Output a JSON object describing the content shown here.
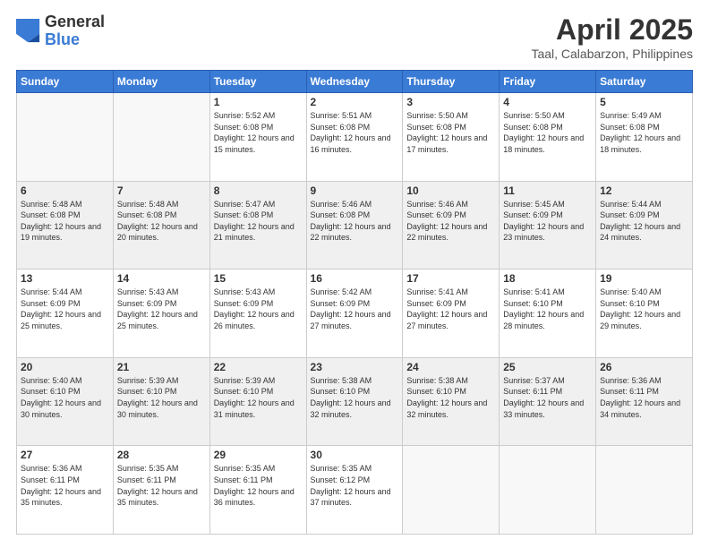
{
  "logo": {
    "general": "General",
    "blue": "Blue"
  },
  "title": {
    "month": "April 2025",
    "location": "Taal, Calabarzon, Philippines"
  },
  "days_of_week": [
    "Sunday",
    "Monday",
    "Tuesday",
    "Wednesday",
    "Thursday",
    "Friday",
    "Saturday"
  ],
  "weeks": [
    [
      {
        "day": "",
        "sunrise": "",
        "sunset": "",
        "daylight": ""
      },
      {
        "day": "",
        "sunrise": "",
        "sunset": "",
        "daylight": ""
      },
      {
        "day": "1",
        "sunrise": "Sunrise: 5:52 AM",
        "sunset": "Sunset: 6:08 PM",
        "daylight": "Daylight: 12 hours and 15 minutes."
      },
      {
        "day": "2",
        "sunrise": "Sunrise: 5:51 AM",
        "sunset": "Sunset: 6:08 PM",
        "daylight": "Daylight: 12 hours and 16 minutes."
      },
      {
        "day": "3",
        "sunrise": "Sunrise: 5:50 AM",
        "sunset": "Sunset: 6:08 PM",
        "daylight": "Daylight: 12 hours and 17 minutes."
      },
      {
        "day": "4",
        "sunrise": "Sunrise: 5:50 AM",
        "sunset": "Sunset: 6:08 PM",
        "daylight": "Daylight: 12 hours and 18 minutes."
      },
      {
        "day": "5",
        "sunrise": "Sunrise: 5:49 AM",
        "sunset": "Sunset: 6:08 PM",
        "daylight": "Daylight: 12 hours and 18 minutes."
      }
    ],
    [
      {
        "day": "6",
        "sunrise": "Sunrise: 5:48 AM",
        "sunset": "Sunset: 6:08 PM",
        "daylight": "Daylight: 12 hours and 19 minutes."
      },
      {
        "day": "7",
        "sunrise": "Sunrise: 5:48 AM",
        "sunset": "Sunset: 6:08 PM",
        "daylight": "Daylight: 12 hours and 20 minutes."
      },
      {
        "day": "8",
        "sunrise": "Sunrise: 5:47 AM",
        "sunset": "Sunset: 6:08 PM",
        "daylight": "Daylight: 12 hours and 21 minutes."
      },
      {
        "day": "9",
        "sunrise": "Sunrise: 5:46 AM",
        "sunset": "Sunset: 6:08 PM",
        "daylight": "Daylight: 12 hours and 22 minutes."
      },
      {
        "day": "10",
        "sunrise": "Sunrise: 5:46 AM",
        "sunset": "Sunset: 6:09 PM",
        "daylight": "Daylight: 12 hours and 22 minutes."
      },
      {
        "day": "11",
        "sunrise": "Sunrise: 5:45 AM",
        "sunset": "Sunset: 6:09 PM",
        "daylight": "Daylight: 12 hours and 23 minutes."
      },
      {
        "day": "12",
        "sunrise": "Sunrise: 5:44 AM",
        "sunset": "Sunset: 6:09 PM",
        "daylight": "Daylight: 12 hours and 24 minutes."
      }
    ],
    [
      {
        "day": "13",
        "sunrise": "Sunrise: 5:44 AM",
        "sunset": "Sunset: 6:09 PM",
        "daylight": "Daylight: 12 hours and 25 minutes."
      },
      {
        "day": "14",
        "sunrise": "Sunrise: 5:43 AM",
        "sunset": "Sunset: 6:09 PM",
        "daylight": "Daylight: 12 hours and 25 minutes."
      },
      {
        "day": "15",
        "sunrise": "Sunrise: 5:43 AM",
        "sunset": "Sunset: 6:09 PM",
        "daylight": "Daylight: 12 hours and 26 minutes."
      },
      {
        "day": "16",
        "sunrise": "Sunrise: 5:42 AM",
        "sunset": "Sunset: 6:09 PM",
        "daylight": "Daylight: 12 hours and 27 minutes."
      },
      {
        "day": "17",
        "sunrise": "Sunrise: 5:41 AM",
        "sunset": "Sunset: 6:09 PM",
        "daylight": "Daylight: 12 hours and 27 minutes."
      },
      {
        "day": "18",
        "sunrise": "Sunrise: 5:41 AM",
        "sunset": "Sunset: 6:10 PM",
        "daylight": "Daylight: 12 hours and 28 minutes."
      },
      {
        "day": "19",
        "sunrise": "Sunrise: 5:40 AM",
        "sunset": "Sunset: 6:10 PM",
        "daylight": "Daylight: 12 hours and 29 minutes."
      }
    ],
    [
      {
        "day": "20",
        "sunrise": "Sunrise: 5:40 AM",
        "sunset": "Sunset: 6:10 PM",
        "daylight": "Daylight: 12 hours and 30 minutes."
      },
      {
        "day": "21",
        "sunrise": "Sunrise: 5:39 AM",
        "sunset": "Sunset: 6:10 PM",
        "daylight": "Daylight: 12 hours and 30 minutes."
      },
      {
        "day": "22",
        "sunrise": "Sunrise: 5:39 AM",
        "sunset": "Sunset: 6:10 PM",
        "daylight": "Daylight: 12 hours and 31 minutes."
      },
      {
        "day": "23",
        "sunrise": "Sunrise: 5:38 AM",
        "sunset": "Sunset: 6:10 PM",
        "daylight": "Daylight: 12 hours and 32 minutes."
      },
      {
        "day": "24",
        "sunrise": "Sunrise: 5:38 AM",
        "sunset": "Sunset: 6:10 PM",
        "daylight": "Daylight: 12 hours and 32 minutes."
      },
      {
        "day": "25",
        "sunrise": "Sunrise: 5:37 AM",
        "sunset": "Sunset: 6:11 PM",
        "daylight": "Daylight: 12 hours and 33 minutes."
      },
      {
        "day": "26",
        "sunrise": "Sunrise: 5:36 AM",
        "sunset": "Sunset: 6:11 PM",
        "daylight": "Daylight: 12 hours and 34 minutes."
      }
    ],
    [
      {
        "day": "27",
        "sunrise": "Sunrise: 5:36 AM",
        "sunset": "Sunset: 6:11 PM",
        "daylight": "Daylight: 12 hours and 35 minutes."
      },
      {
        "day": "28",
        "sunrise": "Sunrise: 5:35 AM",
        "sunset": "Sunset: 6:11 PM",
        "daylight": "Daylight: 12 hours and 35 minutes."
      },
      {
        "day": "29",
        "sunrise": "Sunrise: 5:35 AM",
        "sunset": "Sunset: 6:11 PM",
        "daylight": "Daylight: 12 hours and 36 minutes."
      },
      {
        "day": "30",
        "sunrise": "Sunrise: 5:35 AM",
        "sunset": "Sunset: 6:12 PM",
        "daylight": "Daylight: 12 hours and 37 minutes."
      },
      {
        "day": "",
        "sunrise": "",
        "sunset": "",
        "daylight": ""
      },
      {
        "day": "",
        "sunrise": "",
        "sunset": "",
        "daylight": ""
      },
      {
        "day": "",
        "sunrise": "",
        "sunset": "",
        "daylight": ""
      }
    ]
  ]
}
